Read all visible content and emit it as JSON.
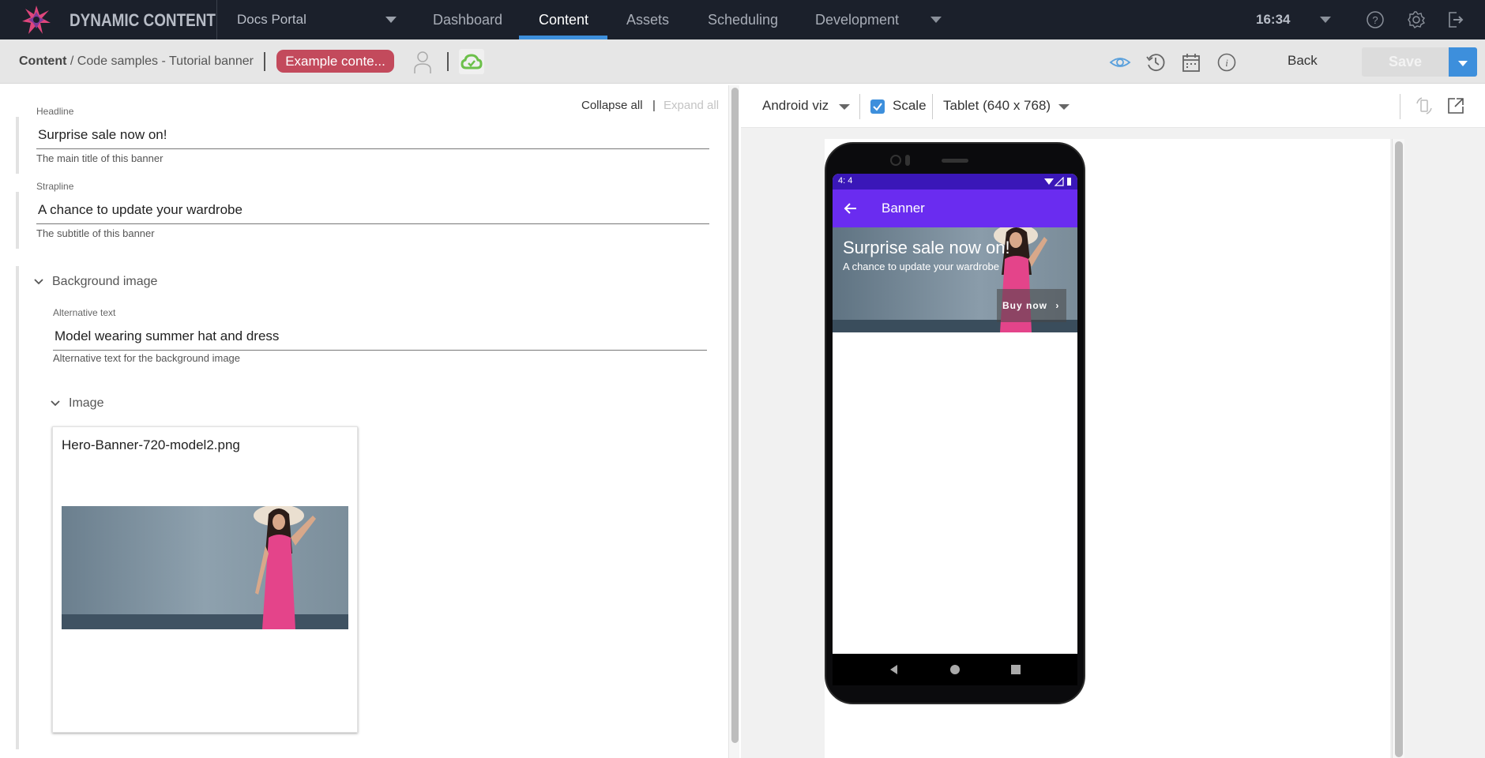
{
  "topbar": {
    "brand": "DYNAMIC CONTENT",
    "hub": "Docs Portal",
    "nav": [
      {
        "label": "Dashboard",
        "active": false
      },
      {
        "label": "Content",
        "active": true
      },
      {
        "label": "Assets",
        "active": false
      },
      {
        "label": "Scheduling",
        "active": false
      },
      {
        "label": "Development",
        "active": false
      }
    ],
    "clock": "16:34",
    "icons": [
      "help-icon",
      "settings-icon",
      "logout-icon"
    ],
    "colors": {
      "background": "#1b202b",
      "active_underline": "#3d8fdc"
    }
  },
  "subbar": {
    "breadcrumb_root": "Content",
    "breadcrumb_path": "/ Code samples - Tutorial banner",
    "tag_label": "Example conte...",
    "tag_color": "#c34a5c",
    "icons": [
      "visualize-icon",
      "history-icon",
      "schedule-calendar-icon",
      "info-icon"
    ],
    "back_label": "Back",
    "save_label": "Save",
    "save_dropdown_color": "#3d8fdc"
  },
  "editor": {
    "collapse_all": "Collapse all",
    "separator": "|",
    "expand_all": "Expand all",
    "fields": [
      {
        "label": "Headline",
        "value": "Surprise sale now on!",
        "help": "The main title of this banner"
      },
      {
        "label": "Strapline",
        "value": "A chance to update your wardrobe",
        "help": "The subtitle of this banner"
      }
    ],
    "background_image": {
      "section_label": "Background image",
      "alt_label": "Alternative text",
      "alt_value": "Model wearing summer hat and dress",
      "alt_help": "Alternative text for the background image",
      "image_section_label": "Image",
      "image_file": "Hero-Banner-720-model2.png"
    }
  },
  "preview": {
    "platform": "Android viz",
    "scale_label": "Scale",
    "scale_checked": true,
    "device": "Tablet (640 x 768)",
    "phone": {
      "status_time": "4: 4",
      "appbar_title": "Banner",
      "hero_title": "Surprise sale now on!",
      "hero_subtitle": "A chance to update your wardrobe",
      "cta": "Buy now",
      "appbar_color": "#6a2cf0"
    }
  }
}
